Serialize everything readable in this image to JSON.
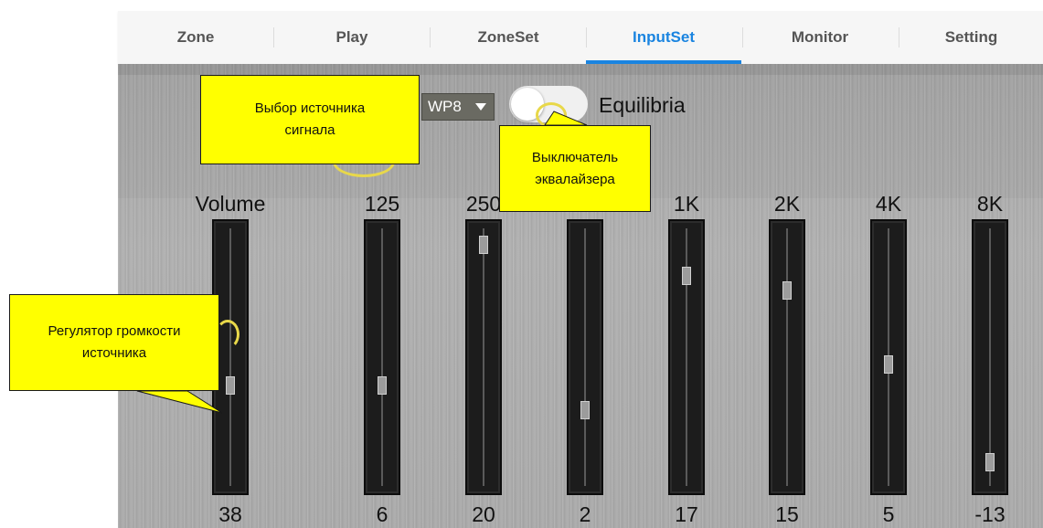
{
  "tabs": [
    {
      "label": "Zone",
      "active": false
    },
    {
      "label": "Play",
      "active": false
    },
    {
      "label": "ZoneSet",
      "active": false
    },
    {
      "label": "InputSet",
      "active": true
    },
    {
      "label": "Monitor",
      "active": false
    },
    {
      "label": "Setting",
      "active": false
    }
  ],
  "accent_color": "#1a84e0",
  "source_select": {
    "value": "WP8"
  },
  "equalizer_toggle": {
    "label": "Equilibria",
    "enabled": false
  },
  "sliders": [
    {
      "label": "Volume",
      "value": "38",
      "level": 0.38
    },
    {
      "label": "125",
      "value": "6",
      "level": 0.38
    },
    {
      "label": "250",
      "value": "20",
      "level": 0.97
    },
    {
      "label": "",
      "value": "2",
      "level": 0.28
    },
    {
      "label": "1K",
      "value": "17",
      "level": 0.84
    },
    {
      "label": "2K",
      "value": "15",
      "level": 0.78
    },
    {
      "label": "4K",
      "value": "5",
      "level": 0.47
    },
    {
      "label": "8K",
      "value": "-13",
      "level": 0.06
    }
  ],
  "callouts": {
    "source": "Выбор источника сигнала",
    "equalizer": "Выключатель эквалайзера",
    "volume": "Регулятор громкости источника"
  },
  "callout_color": "#ffff00"
}
